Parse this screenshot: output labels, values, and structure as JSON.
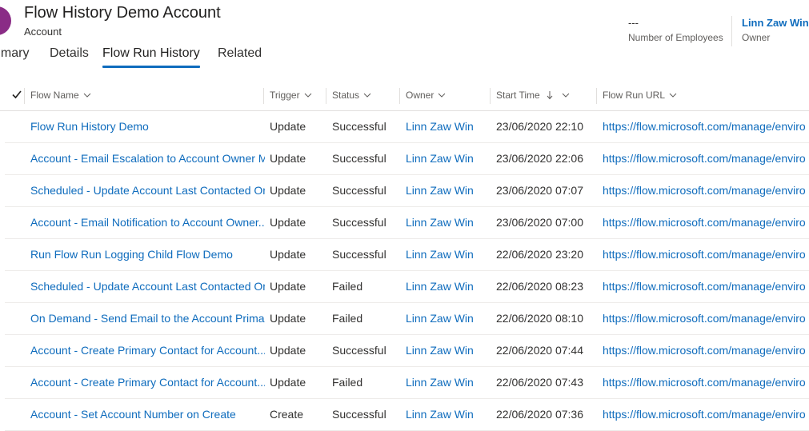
{
  "header": {
    "title": "Flow History Demo Account",
    "entity": "Account",
    "employees_value": "---",
    "employees_label": "Number of Employees",
    "owner_value": "Linn Zaw Win",
    "owner_label": "Owner",
    "avatar_color": "#8a2c86"
  },
  "tabs": [
    "Summary",
    "Details",
    "Flow Run History",
    "Related"
  ],
  "active_tab": "Flow Run History",
  "grid": {
    "columns": {
      "flow_name": "Flow Name",
      "trigger": "Trigger",
      "status": "Status",
      "owner": "Owner",
      "start_time": "Start Time",
      "flow_run_url": "Flow Run URL"
    },
    "rows": [
      {
        "name": "Flow Run History Demo",
        "trigger": "Update",
        "status": "Successful",
        "owner": "Linn Zaw Win",
        "start": "23/06/2020 22:10",
        "url": "https://flow.microsoft.com/manage/enviro"
      },
      {
        "name": "Account - Email Escalation to Account Owner M",
        "trigger": "Update",
        "status": "Successful",
        "owner": "Linn Zaw Win",
        "start": "23/06/2020 22:06",
        "url": "https://flow.microsoft.com/manage/enviro"
      },
      {
        "name": "Scheduled - Update Account Last Contacted On",
        "trigger": "Update",
        "status": "Successful",
        "owner": "Linn Zaw Win",
        "start": "23/06/2020 07:07",
        "url": "https://flow.microsoft.com/manage/enviro"
      },
      {
        "name": "Account - Email Notification to Account Owner...",
        "trigger": "Update",
        "status": "Successful",
        "owner": "Linn Zaw Win",
        "start": "23/06/2020 07:00",
        "url": "https://flow.microsoft.com/manage/enviro"
      },
      {
        "name": "Run Flow Run Logging Child Flow Demo",
        "trigger": "Update",
        "status": "Successful",
        "owner": "Linn Zaw Win",
        "start": "22/06/2020 23:20",
        "url": "https://flow.microsoft.com/manage/enviro"
      },
      {
        "name": "Scheduled - Update Account Last Contacted On",
        "trigger": "Update",
        "status": "Failed",
        "owner": "Linn Zaw Win",
        "start": "22/06/2020 08:23",
        "url": "https://flow.microsoft.com/manage/enviro"
      },
      {
        "name": "On Demand - Send Email to the Account Primary",
        "trigger": "Update",
        "status": "Failed",
        "owner": "Linn Zaw Win",
        "start": "22/06/2020 08:10",
        "url": "https://flow.microsoft.com/manage/enviro"
      },
      {
        "name": "Account - Create Primary Contact for Account...",
        "trigger": "Update",
        "status": "Successful",
        "owner": "Linn Zaw Win",
        "start": "22/06/2020 07:44",
        "url": "https://flow.microsoft.com/manage/enviro"
      },
      {
        "name": "Account - Create Primary Contact for Account...",
        "trigger": "Update",
        "status": "Failed",
        "owner": "Linn Zaw Win",
        "start": "22/06/2020 07:43",
        "url": "https://flow.microsoft.com/manage/enviro"
      },
      {
        "name": "Account - Set Account Number on Create",
        "trigger": "Create",
        "status": "Successful",
        "owner": "Linn Zaw Win",
        "start": "22/06/2020 07:36",
        "url": "https://flow.microsoft.com/manage/enviro"
      }
    ]
  }
}
